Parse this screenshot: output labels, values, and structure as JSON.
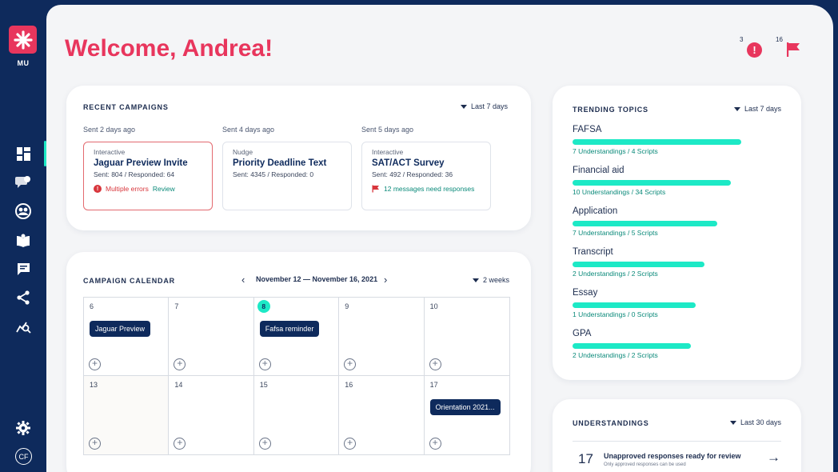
{
  "app": {
    "logo_text": "MU",
    "user_initials": "CF"
  },
  "header": {
    "welcome": "Welcome, Andrea!",
    "alerts_count": "3",
    "flags_count": "16"
  },
  "recent_campaigns": {
    "title": "RECENT CAMPAIGNS",
    "range": "Last 7 days",
    "items": [
      {
        "sent": "Sent 2 days ago",
        "type": "Interactive",
        "name": "Jaguar Preview Invite",
        "stats": "Sent: 804 / Responded: 64",
        "status": "Multiple errors",
        "action": "Review"
      },
      {
        "sent": "Sent 4 days ago",
        "type": "Nudge",
        "name": "Priority Deadline Text",
        "stats": "Sent: 4345 / Responded: 0"
      },
      {
        "sent": "Sent 5 days ago",
        "type": "Interactive",
        "name": "SAT/ACT Survey",
        "stats": "Sent: 492 / Responded: 36",
        "status": "12 messages need responses"
      }
    ]
  },
  "calendar": {
    "title": "CAMPAIGN CALENDAR",
    "date_range": "November 12 — November 16, 2021",
    "range": "2 weeks",
    "days": [
      "6",
      "7",
      "8",
      "9",
      "10",
      "13",
      "14",
      "15",
      "16",
      "17"
    ],
    "events": {
      "e1": "Jaguar Preview",
      "e2": "Fafsa reminder",
      "e3": "Orientation 2021..."
    }
  },
  "trending": {
    "title": "TRENDING TOPICS",
    "range": "Last 7 days",
    "topics": [
      {
        "name": "FAFSA",
        "meta": "7 Understandings / 4 Scripts",
        "level": 1.0
      },
      {
        "name": "Financial aid",
        "meta": "10 Understandings / 34 Scripts",
        "level": 0.94
      },
      {
        "name": "Application",
        "meta": "7 Understandings / 5 Scripts",
        "level": 0.86
      },
      {
        "name": "Transcript",
        "meta": "2 Understandings / 2 Scripts",
        "level": 0.78
      },
      {
        "name": "Essay",
        "meta": "1 Understandings / 0 Scripts",
        "level": 0.73
      },
      {
        "name": "GPA",
        "meta": "2 Understandings / 2 Scripts",
        "level": 0.7
      }
    ]
  },
  "understandings": {
    "title": "UNDERSTANDINGS",
    "range": "Last 30 days",
    "count": "17",
    "headline": "Unapproved responses ready for review",
    "sub": "Only approved responses can be used"
  },
  "colors": {
    "brand": "#e8365d",
    "navy": "#0e2a5c",
    "accent": "#1de9c6",
    "error": "#d8363c"
  }
}
